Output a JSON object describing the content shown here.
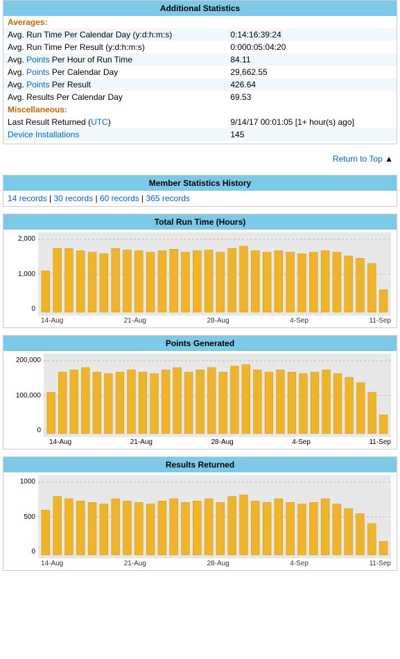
{
  "additionalStats": {
    "title": "Additional Statistics",
    "averagesLabel": "Averages:",
    "rows": [
      {
        "label": "Avg. Run Time Per Calendar Day (y:d:h:m:s)",
        "value": "0:14:16:39:24",
        "hasLink": false,
        "linkText": null
      },
      {
        "label": "Avg. Run Time Per Result (y:d:h:m:s)",
        "value": "0:000:05:04:20",
        "hasLink": false,
        "linkText": null
      },
      {
        "label": "Avg. Points Per Hour of Run Time",
        "value": "84.11",
        "hasLink": true,
        "linkText": "Points"
      },
      {
        "label": "Avg. Points Per Calendar Day",
        "value": "29,662.55",
        "hasLink": true,
        "linkText": "Points"
      },
      {
        "label": "Avg. Points Per Result",
        "value": "426.64",
        "hasLink": true,
        "linkText": "Points"
      },
      {
        "label": "Avg. Results Per Calendar Day",
        "value": "69.53",
        "hasLink": false,
        "linkText": null
      }
    ],
    "miscLabel": "Miscellaneous:",
    "miscRows": [
      {
        "label": "Last Result Returned (UTC)",
        "value": "9/14/17 00:01:05 [1+ hour(s) ago]",
        "hasLink": true,
        "linkText": "UTC"
      },
      {
        "label": "Device Installations",
        "value": "145",
        "hasLink": true,
        "linkText": "Device Installations"
      }
    ]
  },
  "returnToTop": "Return to Top",
  "memberStats": {
    "title": "Member Statistics History",
    "records": {
      "prefix": "",
      "items": [
        {
          "label": "14 records",
          "value": "14"
        },
        {
          "label": "30 records",
          "value": "30"
        },
        {
          "label": "60 records",
          "value": "60"
        },
        {
          "label": "365 records",
          "value": "365"
        }
      ]
    }
  },
  "charts": {
    "runTime": {
      "title": "Total Run Time (Hours)",
      "yLabels": [
        "2,000",
        "1,000",
        "0"
      ],
      "xLabels": [
        "14-Aug",
        "21-Aug",
        "28-Aug",
        "4-Sep",
        "11-Sep"
      ],
      "bars": [
        55,
        85,
        85,
        82,
        80,
        78,
        85,
        83,
        82,
        80,
        82,
        84,
        80,
        82,
        83,
        80,
        85,
        88,
        82,
        80,
        82,
        80,
        78,
        80,
        82,
        80,
        75,
        72,
        65,
        30
      ]
    },
    "points": {
      "title": "Points Generated",
      "yLabels": [
        "200,000",
        "100,000",
        "0"
      ],
      "xLabels": [
        "14-Aug",
        "21-Aug",
        "28-Aug",
        "4-Sep",
        "11-Sep"
      ],
      "bars": [
        55,
        82,
        85,
        88,
        82,
        80,
        82,
        85,
        82,
        80,
        85,
        88,
        82,
        85,
        88,
        82,
        90,
        92,
        85,
        82,
        85,
        82,
        80,
        82,
        85,
        80,
        75,
        68,
        55,
        25
      ]
    },
    "results": {
      "title": "Results Returned",
      "yLabels": [
        "1000",
        "500",
        "0"
      ],
      "xLabels": [
        "14-Aug",
        "21-Aug",
        "28-Aug",
        "4-Sep",
        "11-Sep"
      ],
      "bars": [
        60,
        78,
        75,
        72,
        70,
        68,
        75,
        72,
        70,
        68,
        72,
        75,
        70,
        72,
        75,
        70,
        78,
        80,
        72,
        70,
        75,
        70,
        68,
        70,
        75,
        68,
        62,
        55,
        42,
        18
      ]
    }
  }
}
